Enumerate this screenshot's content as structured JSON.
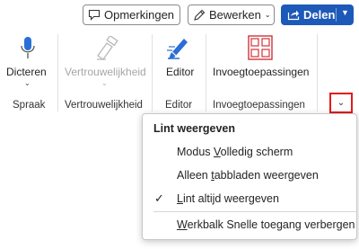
{
  "topbar": {
    "comments_label": "Opmerkingen",
    "edit_label": "Bewerken",
    "share_label": "Delen"
  },
  "ribbon": {
    "groups": [
      {
        "tool": "Dicteren",
        "label": "Spraak"
      },
      {
        "tool": "Vertrouwelijkheid",
        "label": "Vertrouwelijkheid"
      },
      {
        "tool": "Editor",
        "label": "Editor"
      },
      {
        "tool": "Invoegtoepassingen",
        "label": "Invoegtoepassingen"
      }
    ]
  },
  "menu": {
    "title": "Lint weergeven",
    "items": [
      {
        "pre": "Modus ",
        "key": "V",
        "post": "olledig scherm",
        "checked": false
      },
      {
        "pre": "Alleen ",
        "key": "t",
        "post": "abbladen weergeven",
        "checked": false
      },
      {
        "pre": "",
        "key": "L",
        "post": "int altijd weergeven",
        "checked": true
      },
      {
        "pre": "",
        "key": "W",
        "post": "erkbalk Snelle toegang verbergen",
        "checked": false
      }
    ]
  },
  "colors": {
    "accent": "#1d59b8",
    "highlight": "#e21b1b"
  }
}
